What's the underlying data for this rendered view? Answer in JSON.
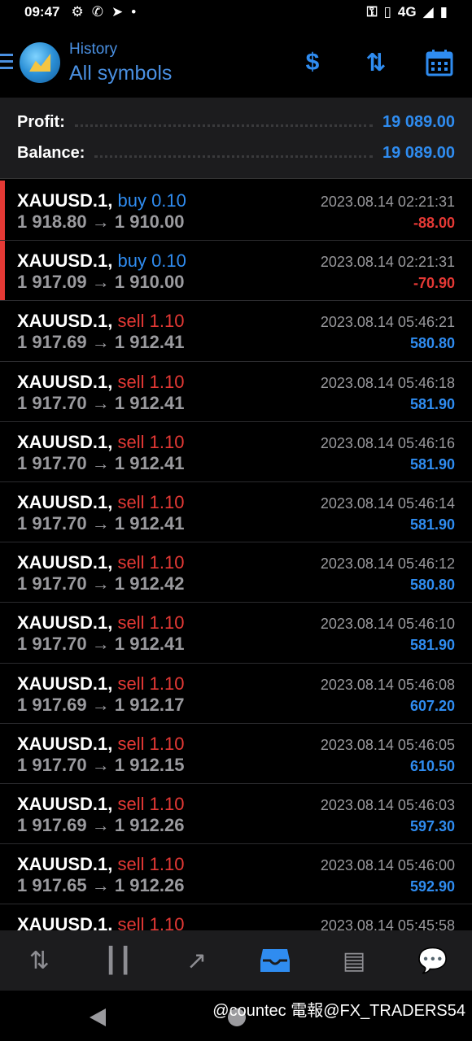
{
  "status": {
    "time": "09:47",
    "network": "4G"
  },
  "header": {
    "title": "History",
    "subtitle": "All symbols"
  },
  "summary": {
    "profit_label": "Profit:",
    "profit_value": "19 089.00",
    "balance_label": "Balance:",
    "balance_value": "19 089.00"
  },
  "deals": [
    {
      "symbol": "XAUUSD.1,",
      "type": "buy 0.10",
      "prices": "1 918.80 → 1 910.00",
      "time": "2023.08.14 02:21:31",
      "profit": "-88.00"
    },
    {
      "symbol": "XAUUSD.1,",
      "type": "buy 0.10",
      "prices": "1 917.09 → 1 910.00",
      "time": "2023.08.14 02:21:31",
      "profit": "-70.90"
    },
    {
      "symbol": "XAUUSD.1,",
      "type": "sell 1.10",
      "prices": "1 917.69 → 1 912.41",
      "time": "2023.08.14 05:46:21",
      "profit": "580.80"
    },
    {
      "symbol": "XAUUSD.1,",
      "type": "sell 1.10",
      "prices": "1 917.70 → 1 912.41",
      "time": "2023.08.14 05:46:18",
      "profit": "581.90"
    },
    {
      "symbol": "XAUUSD.1,",
      "type": "sell 1.10",
      "prices": "1 917.70 → 1 912.41",
      "time": "2023.08.14 05:46:16",
      "profit": "581.90"
    },
    {
      "symbol": "XAUUSD.1,",
      "type": "sell 1.10",
      "prices": "1 917.70 → 1 912.41",
      "time": "2023.08.14 05:46:14",
      "profit": "581.90"
    },
    {
      "symbol": "XAUUSD.1,",
      "type": "sell 1.10",
      "prices": "1 917.70 → 1 912.42",
      "time": "2023.08.14 05:46:12",
      "profit": "580.80"
    },
    {
      "symbol": "XAUUSD.1,",
      "type": "sell 1.10",
      "prices": "1 917.70 → 1 912.41",
      "time": "2023.08.14 05:46:10",
      "profit": "581.90"
    },
    {
      "symbol": "XAUUSD.1,",
      "type": "sell 1.10",
      "prices": "1 917.69 → 1 912.17",
      "time": "2023.08.14 05:46:08",
      "profit": "607.20"
    },
    {
      "symbol": "XAUUSD.1,",
      "type": "sell 1.10",
      "prices": "1 917.70 → 1 912.15",
      "time": "2023.08.14 05:46:05",
      "profit": "610.50"
    },
    {
      "symbol": "XAUUSD.1,",
      "type": "sell 1.10",
      "prices": "1 917.69 → 1 912.26",
      "time": "2023.08.14 05:46:03",
      "profit": "597.30"
    },
    {
      "symbol": "XAUUSD.1,",
      "type": "sell 1.10",
      "prices": "1 917.65 → 1 912.26",
      "time": "2023.08.14 05:46:00",
      "profit": "592.90"
    },
    {
      "symbol": "XAUUSD.1,",
      "type": "sell 1.10",
      "prices": "",
      "time": "2023.08.14 05:45:58",
      "profit": ""
    }
  ],
  "nav": {
    "items": [
      {
        "icon": "quotes-icon"
      },
      {
        "icon": "chart-icon"
      },
      {
        "icon": "trade-icon"
      },
      {
        "icon": "history-icon",
        "active": true
      },
      {
        "icon": "news-icon"
      },
      {
        "icon": "chat-icon"
      }
    ]
  },
  "watermark": "@countec 電報@FX_TRADERS54",
  "colors": {
    "accent": "#2f8cf0",
    "sell": "#e53935",
    "background": "#000000",
    "panel": "#1c1c1e"
  }
}
